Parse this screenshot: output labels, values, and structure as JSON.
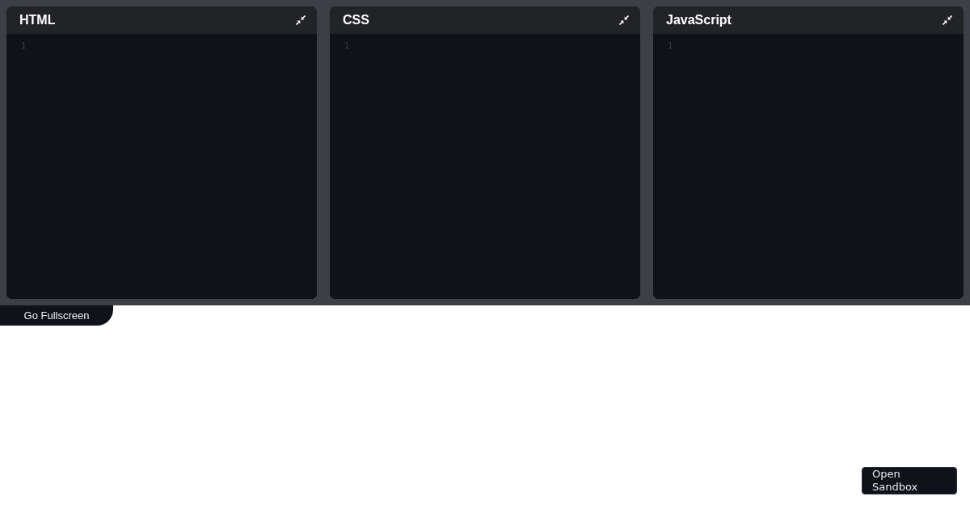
{
  "editors": [
    {
      "title": "HTML",
      "line_numbers": [
        "1"
      ]
    },
    {
      "title": "CSS",
      "line_numbers": [
        "1"
      ]
    },
    {
      "title": "JavaScript",
      "line_numbers": [
        "1"
      ]
    }
  ],
  "fullscreen_button": {
    "label": "Go Fullscreen"
  },
  "sandbox_button": {
    "label": "Open Sandbox"
  }
}
